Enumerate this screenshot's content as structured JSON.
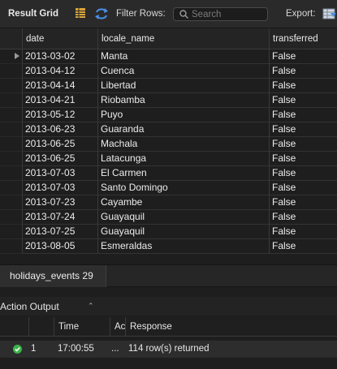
{
  "toolbar": {
    "title": "Result Grid",
    "filter_label": "Filter Rows:",
    "search_placeholder": "Search",
    "export_label": "Export:"
  },
  "grid": {
    "columns": [
      "date",
      "locale_name",
      "transferred"
    ],
    "rows": [
      [
        "2013-03-02",
        "Manta",
        "False"
      ],
      [
        "2013-04-12",
        "Cuenca",
        "False"
      ],
      [
        "2013-04-14",
        "Libertad",
        "False"
      ],
      [
        "2013-04-21",
        "Riobamba",
        "False"
      ],
      [
        "2013-05-12",
        "Puyo",
        "False"
      ],
      [
        "2013-06-23",
        "Guaranda",
        "False"
      ],
      [
        "2013-06-25",
        "Machala",
        "False"
      ],
      [
        "2013-06-25",
        "Latacunga",
        "False"
      ],
      [
        "2013-07-03",
        "El Carmen",
        "False"
      ],
      [
        "2013-07-03",
        "Santo Domingo",
        "False"
      ],
      [
        "2013-07-23",
        "Cayambe",
        "False"
      ],
      [
        "2013-07-24",
        "Guayaquil",
        "False"
      ],
      [
        "2013-07-25",
        "Guayaquil",
        "False"
      ],
      [
        "2013-08-05",
        "Esmeraldas",
        "False"
      ]
    ]
  },
  "result_tab": {
    "label": "holidays_events 29"
  },
  "action_output": {
    "title": "Action Output",
    "columns": {
      "time": "Time",
      "action": "Ac",
      "response": "Response"
    },
    "rows": [
      {
        "num": "1",
        "time": "17:00:55",
        "action": "...",
        "response": "114 row(s) returned",
        "status": "success"
      }
    ]
  },
  "colors": {
    "success": "#3bb54a",
    "accent": "#4a8fe7"
  }
}
